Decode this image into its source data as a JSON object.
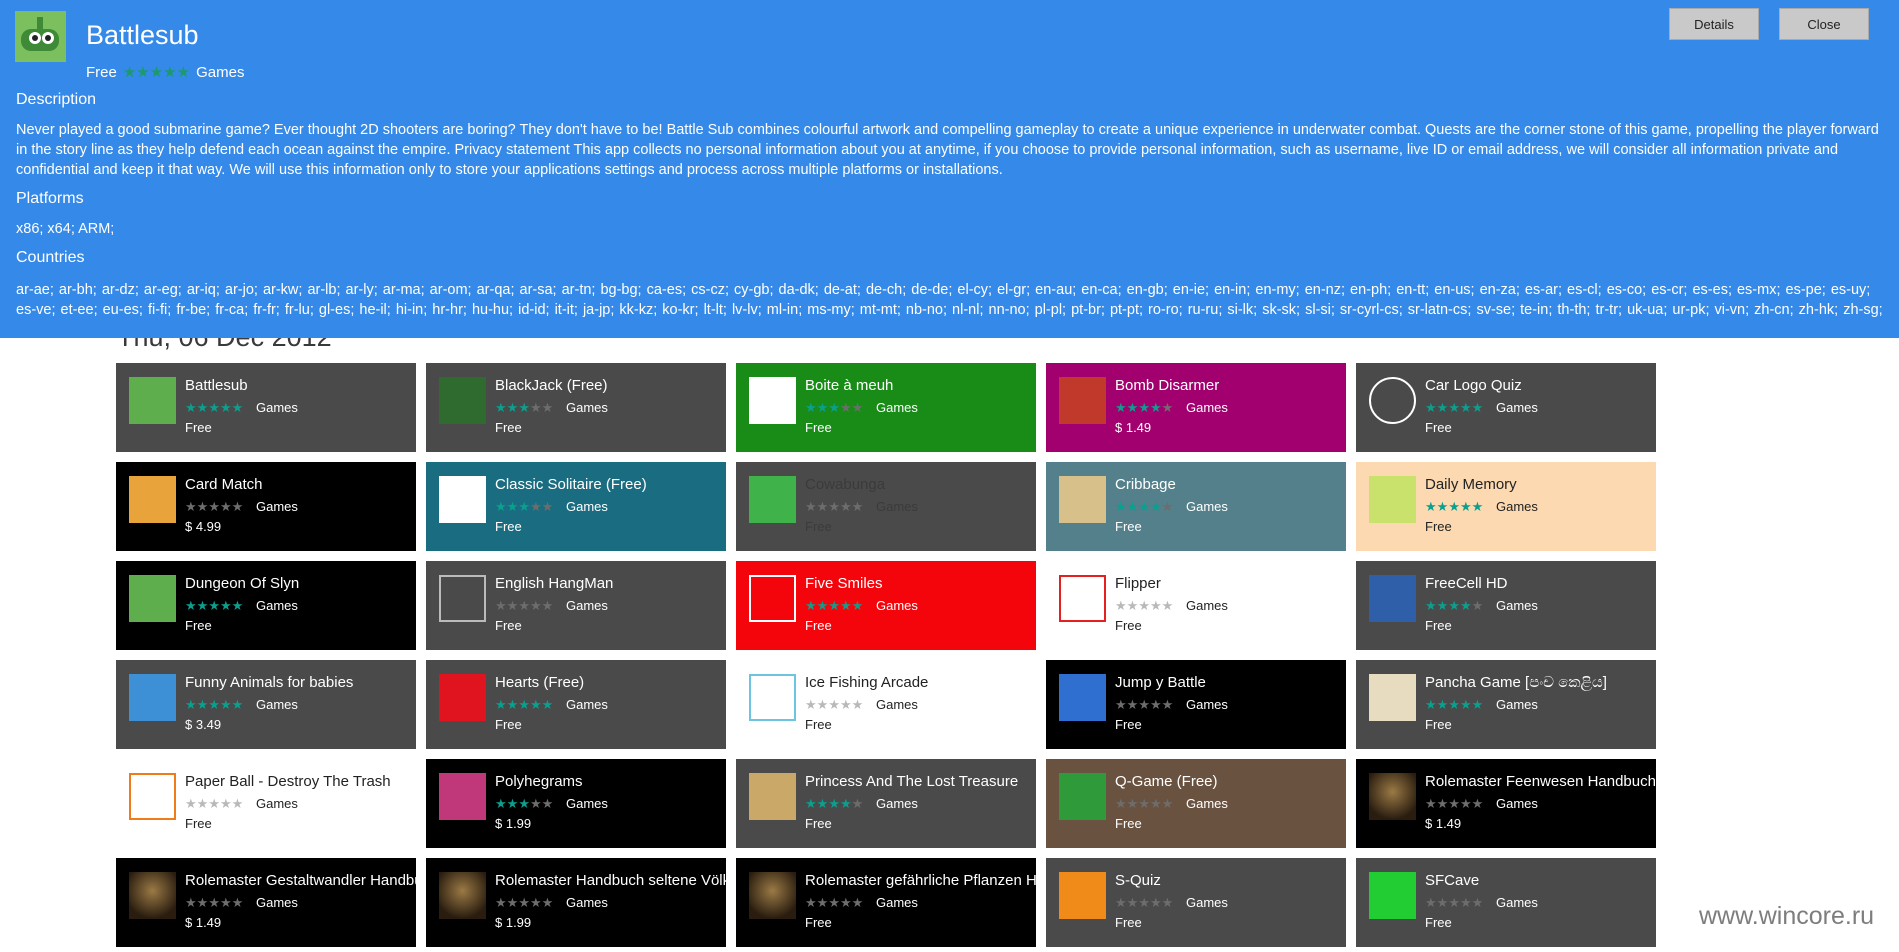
{
  "details": {
    "app_name": "Battlesub",
    "price": "Free",
    "category": "Games",
    "stars": "★★★★★",
    "details_label": "Details",
    "close_label": "Close",
    "description_heading": "Description",
    "description": "Never played a good submarine game? Ever thought 2D shooters are boring? They don't have to be! Battle Sub combines colourful artwork and compelling gameplay to create a unique experience in underwater combat. Quests are the corner stone of this game, propelling the player forward in the story line as they help defend each ocean against the empire. Privacy statement This app collects no personal information about you at anytime, if you choose to provide personal information, such as username, live ID or email address, we will consider all information private and confidential and keep it that way. We will use this information only to store your applications settings and process across multiple platforms or installations.",
    "platforms_heading": "Platforms",
    "platforms": "x86; x64; ARM;",
    "countries_heading": "Countries",
    "countries": "ar-ae; ar-bh; ar-dz; ar-eg; ar-iq; ar-jo; ar-kw; ar-lb; ar-ly; ar-ma; ar-om; ar-qa; ar-sa; ar-tn; bg-bg; ca-es; cs-cz; cy-gb; da-dk; de-at; de-ch; de-de; el-cy; el-gr; en-au; en-ca; en-gb; en-ie; en-in; en-my; en-nz; en-ph; en-tt; en-us; en-za; es-ar; es-cl; es-co; es-cr; es-es; es-mx; es-pe; es-uy; es-ve; et-ee; eu-es; fi-fi; fr-be; fr-ca; fr-fr; fr-lu; gl-es; he-il; hi-in; hr-hr; hu-hu; id-id; it-it; ja-jp; kk-kz; ko-kr; lt-lt; lv-lv; ml-in; ms-my; mt-mt; nb-no; nl-nl; nn-no; pl-pl; pt-br; pt-pt; ro-ro; ru-ru; si-lk; sk-sk; sl-si; sr-cyrl-cs; sr-latn-cs; sv-se; te-in; th-th; tr-tr; uk-ua; ur-pk; vi-vn; zh-cn; zh-hk; zh-sg; zh-tw;"
  },
  "date_heading": "Thu, 06 Dec 2012",
  "watermark": "www.wincore.ru",
  "apps": [
    {
      "name": "Battlesub",
      "category": "Games",
      "price": "Free",
      "rating": 5,
      "style": "grey",
      "icon": "battlesub-icon",
      "icon_color": "#5fae4e"
    },
    {
      "name": "BlackJack (Free)",
      "category": "Games",
      "price": "Free",
      "rating": 3,
      "style": "grey",
      "icon": "cards-icon",
      "icon_color": "#2f6b2f"
    },
    {
      "name": "Boite à meuh",
      "category": "Games",
      "price": "Free",
      "rating": 3,
      "style": "green",
      "icon": "cow-icon",
      "icon_color": "#ffffff"
    },
    {
      "name": "Bomb Disarmer",
      "category": "Games",
      "price": "$ 1.49",
      "rating": 4,
      "style": "magenta",
      "icon": "bomb-icon",
      "icon_color": "#c0392b"
    },
    {
      "name": "Car Logo Quiz",
      "category": "Games",
      "price": "Free",
      "rating": 5,
      "style": "grey",
      "icon": "car-icon",
      "icon_color": "#ffffff"
    },
    {
      "name": "Card Match",
      "category": "Games",
      "price": "$ 4.99",
      "rating": 0,
      "style": "black",
      "icon": "card-match-icon",
      "icon_color": "#e8a33a"
    },
    {
      "name": "Classic Solitaire (Free)",
      "category": "Games",
      "price": "Free",
      "rating": 3,
      "style": "teal",
      "icon": "spade-icon",
      "icon_color": "#ffffff"
    },
    {
      "name": "Cowabunga",
      "category": "Games",
      "price": "Free",
      "rating": 0,
      "style": "grey",
      "icon": "cowabunga-icon",
      "icon_color": "#3fb24a"
    },
    {
      "name": "Cribbage",
      "category": "Games",
      "price": "Free",
      "rating": 4,
      "style": "slate",
      "icon": "cribbage-icon",
      "icon_color": "#d8c08a"
    },
    {
      "name": "Daily Memory",
      "category": "Games",
      "price": "Free",
      "rating": 5,
      "style": "peach",
      "icon": "memory-icon",
      "icon_color": "#c9e26b"
    },
    {
      "name": "Dungeon Of Slyn",
      "category": "Games",
      "price": "Free",
      "rating": 5,
      "style": "black",
      "icon": "dungeon-icon",
      "icon_color": "#5fae4e"
    },
    {
      "name": "English HangMan",
      "category": "Games",
      "price": "Free",
      "rating": 0,
      "style": "grey",
      "icon": "hangman-icon",
      "icon_color": "#bbbbbb"
    },
    {
      "name": "Five Smiles",
      "category": "Games",
      "price": "Free",
      "rating": 5,
      "style": "red",
      "icon": "smile-icon",
      "icon_color": "#ffffff"
    },
    {
      "name": "Flipper",
      "category": "Games",
      "price": "Free",
      "rating": 0,
      "style": "white",
      "icon": "flipper-icon",
      "icon_color": "#e52020"
    },
    {
      "name": "FreeCell HD",
      "category": "Games",
      "price": "Free",
      "rating": 4,
      "style": "grey",
      "icon": "freecell-icon",
      "icon_color": "#2f5fa8"
    },
    {
      "name": "Funny Animals for babies",
      "category": "Games",
      "price": "$ 3.49",
      "rating": 5,
      "style": "grey",
      "icon": "animals-icon",
      "icon_color": "#3d8fd6"
    },
    {
      "name": "Hearts (Free)",
      "category": "Games",
      "price": "Free",
      "rating": 5,
      "style": "grey",
      "icon": "hearts-icon",
      "icon_color": "#e0141e"
    },
    {
      "name": "Ice Fishing Arcade",
      "category": "Games",
      "price": "Free",
      "rating": 0,
      "style": "white",
      "icon": "fishing-icon",
      "icon_color": "#6cc4e0"
    },
    {
      "name": "Jump y Battle",
      "category": "Games",
      "price": "Free",
      "rating": 0,
      "style": "black",
      "icon": "jump-icon",
      "icon_color": "#2f6fd0"
    },
    {
      "name": "Pancha Game [පංච කෙළිය]",
      "category": "Games",
      "price": "Free",
      "rating": 5,
      "style": "grey",
      "icon": "pancha-icon",
      "icon_color": "#e8dcc0"
    },
    {
      "name": "Paper Ball - Destroy The Trash",
      "category": "Games",
      "price": "Free",
      "rating": 0,
      "style": "white",
      "icon": "paperball-icon",
      "icon_color": "#f07b1a"
    },
    {
      "name": "Polyhegrams",
      "category": "Games",
      "price": "$ 1.99",
      "rating": 3,
      "style": "black",
      "icon": "poly-icon",
      "icon_color": "#c0377a"
    },
    {
      "name": "Princess And The Lost Treasure",
      "category": "Games",
      "price": "Free",
      "rating": 4,
      "style": "grey",
      "icon": "treasure-map-icon",
      "icon_color": "#c9a868"
    },
    {
      "name": "Q-Game (Free)",
      "category": "Games",
      "price": "Free",
      "rating": 0,
      "style": "brown",
      "icon": "qgame-icon",
      "icon_color": "#2e9a3a"
    },
    {
      "name": "Rolemaster Feenwesen Handbuch",
      "category": "Games",
      "price": "$ 1.49",
      "rating": 0,
      "style": "black",
      "icon": "dragon-icon",
      "icon_color": "#8a6a3a"
    },
    {
      "name": "Rolemaster Gestaltwandler Handbuch",
      "category": "Games",
      "price": "$ 1.49",
      "rating": 0,
      "style": "black",
      "icon": "dragon-icon",
      "icon_color": "#8a6a3a"
    },
    {
      "name": "Rolemaster Handbuch seltene Völker",
      "category": "Games",
      "price": "$ 1.99",
      "rating": 0,
      "style": "black",
      "icon": "dragon-icon",
      "icon_color": "#8a6a3a"
    },
    {
      "name": "Rolemaster gefährliche Pflanzen Handbuch",
      "category": "Games",
      "price": "Free",
      "rating": 0,
      "style": "black",
      "icon": "dragon-icon",
      "icon_color": "#8a6a3a"
    },
    {
      "name": "S-Quiz",
      "category": "Games",
      "price": "Free",
      "rating": 0,
      "style": "grey",
      "icon": "question-block-icon",
      "icon_color": "#f08a18"
    },
    {
      "name": "SFCave",
      "category": "Games",
      "price": "Free",
      "rating": 0,
      "style": "grey",
      "icon": "cave-icon",
      "icon_color": "#22cc33"
    }
  ]
}
